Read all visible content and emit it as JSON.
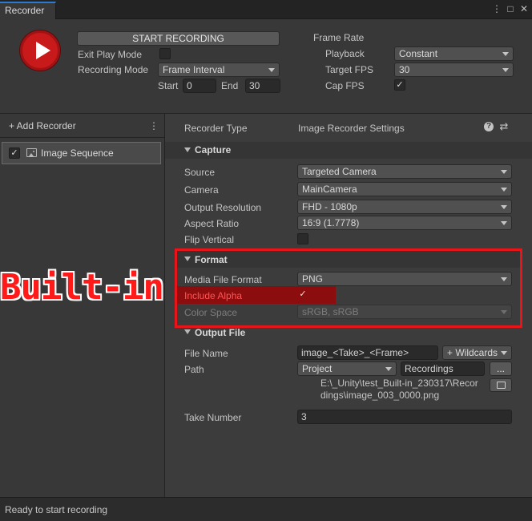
{
  "window": {
    "tab_label": "Recorder",
    "menu_icon": "kebab-menu-icon",
    "maximize_icon": "maximize-icon",
    "close_icon": "close-icon",
    "close_glyph": "✕",
    "menu_glyph": "⋮",
    "maximize_glyph": "□"
  },
  "controls": {
    "start_recording_label": "START RECORDING",
    "exit_play_mode_label": "Exit Play Mode",
    "exit_play_mode_checked": false,
    "recording_mode_label": "Recording Mode",
    "recording_mode_value": "Frame Interval",
    "start_label": "Start",
    "start_value": "0",
    "end_label": "End",
    "end_value": "30",
    "frame_rate_label": "Frame Rate",
    "playback_label": "Playback",
    "playback_value": "Constant",
    "target_fps_label": "Target FPS",
    "target_fps_value": "30",
    "cap_fps_label": "Cap FPS",
    "cap_fps_checked": true,
    "check_glyph": "✓"
  },
  "recorder_list": {
    "add_recorder_label": "+ Add Recorder",
    "more_glyph": "⋮",
    "items": [
      {
        "label": "Image Sequence",
        "enabled": true
      }
    ]
  },
  "settings": {
    "recorder_type_label": "Recorder Type",
    "recorder_type_value": "Image Recorder Settings",
    "help_glyph": "?",
    "presets_glyph": "⇄",
    "capture": {
      "title": "Capture",
      "source_label": "Source",
      "source_value": "Targeted Camera",
      "camera_label": "Camera",
      "camera_value": "MainCamera",
      "output_resolution_label": "Output Resolution",
      "output_resolution_value": "FHD - 1080p",
      "aspect_ratio_label": "Aspect Ratio",
      "aspect_ratio_value": "16:9 (1.7778)",
      "flip_vertical_label": "Flip Vertical",
      "flip_vertical_checked": false
    },
    "format": {
      "title": "Format",
      "media_file_format_label": "Media File Format",
      "media_file_format_value": "PNG",
      "include_alpha_label": "Include Alpha",
      "include_alpha_checked": true,
      "color_space_label": "Color Space",
      "color_space_value": "sRGB, sRGB"
    },
    "output_file": {
      "title": "Output File",
      "file_name_label": "File Name",
      "file_name_value": "image_<Take>_<Frame>",
      "wildcards_label": "+ Wildcards",
      "path_label": "Path",
      "path_root_value": "Project",
      "path_folder_value": "Recordings",
      "browse_label": "...",
      "resolved_path_line1": "E:\\_Unity\\test_Built-in_230317\\Recor",
      "resolved_path_line2": "dings\\image_003_0000.png",
      "open_folder_icon": "open-folder-icon",
      "take_number_label": "Take Number",
      "take_number_value": "3"
    }
  },
  "status": {
    "text": "Ready to start recording"
  },
  "annotation": {
    "label": "Built-in"
  },
  "colors": {
    "record_button": "#c8191b",
    "highlight_box": "#e8141a",
    "include_alpha_highlight": "#8b0d0d",
    "include_alpha_text": "#ff5555",
    "tab_accent": "#2d7bd1"
  }
}
